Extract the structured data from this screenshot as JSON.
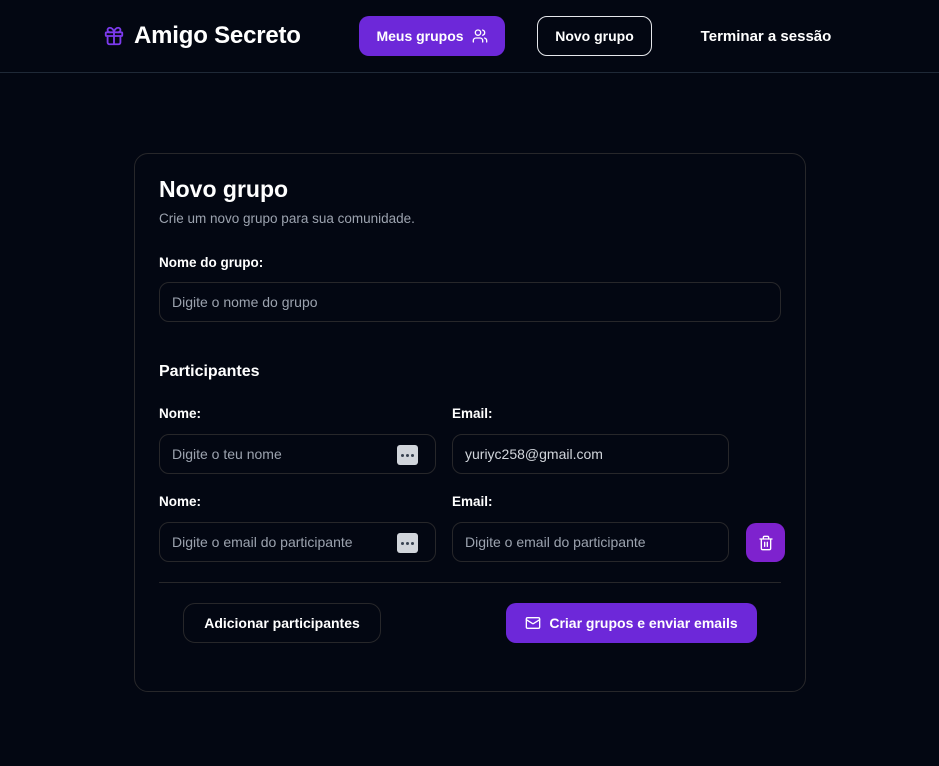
{
  "header": {
    "brand_icon": "gift-icon",
    "brand_title": "Amigo Secreto",
    "nav": {
      "my_groups": "Meus grupos",
      "my_groups_icon": "users-icon",
      "new_group": "Novo grupo",
      "logout": "Terminar a sessão"
    }
  },
  "form": {
    "title": "Novo grupo",
    "subtitle": "Crie um novo grupo para sua comunidade.",
    "group_name_label": "Nome do grupo:",
    "group_name_placeholder": "Digite o nome do grupo",
    "group_name_value": "",
    "participants_title": "Participantes",
    "participants": [
      {
        "name_label": "Nome:",
        "name_placeholder": "Digite o teu nome",
        "name_value": "",
        "email_label": "Email:",
        "email_placeholder": "",
        "email_value": "yuriyc258@gmail.com",
        "removable": false
      },
      {
        "name_label": "Nome:",
        "name_placeholder": "Digite o email do participante",
        "name_value": "",
        "email_label": "Email:",
        "email_placeholder": "Digite o email do participante",
        "email_value": "",
        "removable": true,
        "remove_icon": "trash-icon"
      }
    ],
    "add_button": "Adicionar participantes",
    "submit_button": "Criar grupos e enviar emails",
    "submit_icon": "mail-icon"
  },
  "colors": {
    "background": "#030712",
    "accent": "#6d28d9",
    "danger_accent": "#7e22ce",
    "border": "#27272a",
    "muted_text": "#9ca3af"
  }
}
